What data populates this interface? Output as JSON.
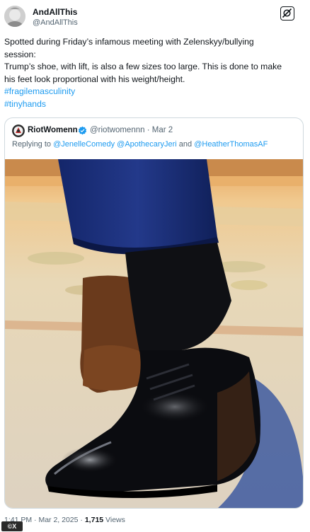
{
  "tweet": {
    "display_name": "AndAllThis",
    "handle": "@AndAllThis",
    "text_lines": [
      "Spotted during Friday’s infamous meeting with Zelenskyy/bullying",
      "session:",
      "Trump’s shoe, with lift, is also a few sizes too large. This is done to make",
      "his feet look proportional with his weight/height."
    ],
    "hashtags": [
      "#fragilemasculinity",
      "#tinyhands"
    ],
    "icons": {
      "avatar": "profile-photo",
      "grok": "grok-icon"
    }
  },
  "quote": {
    "display_name": "RiotWomenn",
    "verified": true,
    "handle": "@riotwomennn",
    "separator": "·",
    "date": "Mar 2",
    "reply_prefix": "Replying to",
    "mentions": [
      "@JenelleComedy",
      "@ApothecaryJeri",
      "@HeatherThomasAF"
    ],
    "reply_and": "and",
    "image": "photo-shoe-closeup"
  },
  "footer": {
    "time": "1:41 PM",
    "dot1": "·",
    "date": "Mar 2, 2025",
    "dot2": "·",
    "views_count": "1,715",
    "views_label": "Views"
  },
  "badge": {
    "label": "©X"
  },
  "colors": {
    "link": "#1d9bf0",
    "muted": "#536471",
    "text": "#0f1419",
    "border": "#cfd9de"
  }
}
